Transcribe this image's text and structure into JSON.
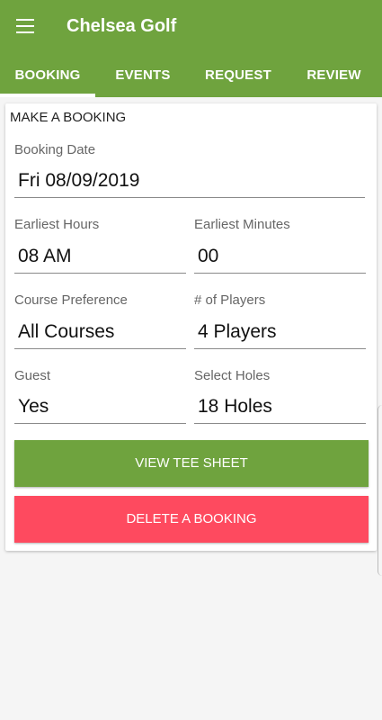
{
  "app": {
    "title": "Chelsea Golf"
  },
  "tabs": [
    {
      "label": "BOOKING"
    },
    {
      "label": "EVENTS"
    },
    {
      "label": "REQUEST"
    },
    {
      "label": "REVIEW"
    }
  ],
  "card": {
    "title": "MAKE A BOOKING",
    "booking_date": {
      "label": "Booking Date",
      "value": "Fri 08/09/2019"
    },
    "earliest_hours": {
      "label": "Earliest Hours",
      "value": "08 AM"
    },
    "earliest_minutes": {
      "label": "Earliest Minutes",
      "value": "00"
    },
    "course_preference": {
      "label": "Course Preference",
      "value": "All Courses"
    },
    "players": {
      "label": "# of Players",
      "value": "4 Players"
    },
    "guest": {
      "label": "Guest",
      "value": "Yes"
    },
    "holes": {
      "label": "Select Holes",
      "value": "18 Holes"
    },
    "view_tee_sheet_label": "VIEW TEE SHEET",
    "delete_booking_label": "DELETE A BOOKING"
  },
  "colors": {
    "brand_green": "#6fa33e",
    "delete_red": "#fe4a5f"
  },
  "icons": {
    "menu": "hamburger-menu-icon"
  }
}
